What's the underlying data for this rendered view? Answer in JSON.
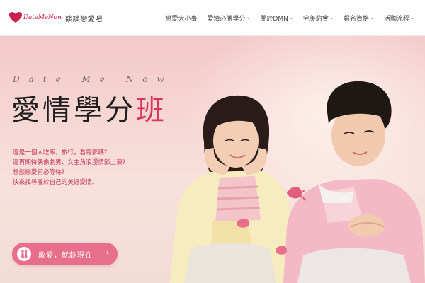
{
  "header": {
    "logo_text": "DateMeNow",
    "logo_cn": "談談戀愛吧",
    "nav": [
      {
        "label": "戀愛大小事",
        "has_caret": false
      },
      {
        "label": "愛情必勝學分",
        "has_caret": true
      },
      {
        "label": "關於DMN",
        "has_caret": true
      },
      {
        "label": "完美約會",
        "has_caret": true
      },
      {
        "label": "報名資格",
        "has_caret": true
      },
      {
        "label": "活動流程",
        "has_caret": true
      }
    ],
    "caret": "⌄"
  },
  "hero": {
    "eyebrow": "Date Me Now",
    "title_main": "愛情學分",
    "title_accent": "班",
    "intro_lines": [
      "還是一個人吃飯，旅行，看電影嗎？",
      "還再期待偶像劇男、女主角浪漫情節上演?",
      "想談戀愛何必等待?",
      "快來找尋屬於自己的美好愛情。"
    ],
    "cta_label": "敢愛，就趁現在",
    "cta_arrow": "›"
  },
  "colors": {
    "accent": "#d9385e",
    "cta_bg": "#e86f8c",
    "intro_text": "#c33555",
    "hero_bg": "#f6d7d4"
  },
  "icons": {
    "logo": "heart-logo-icon",
    "cta": "couple-icon"
  }
}
